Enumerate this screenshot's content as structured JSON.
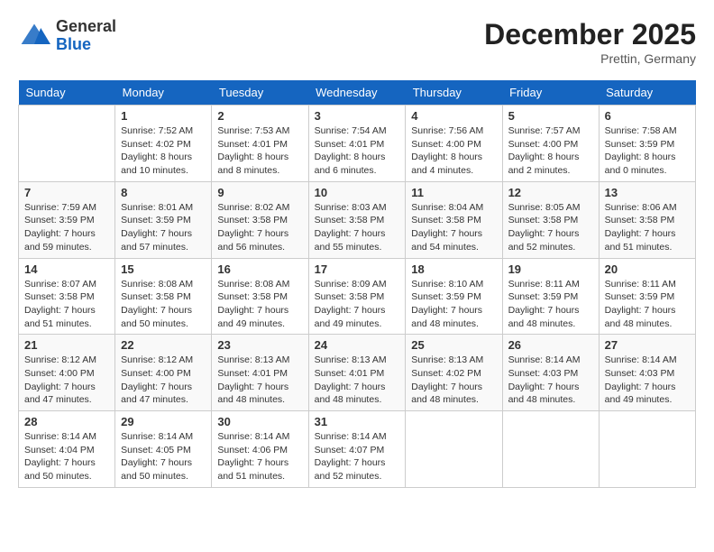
{
  "header": {
    "logo_general": "General",
    "logo_blue": "Blue",
    "month_title": "December 2025",
    "location": "Prettin, Germany"
  },
  "weekdays": [
    "Sunday",
    "Monday",
    "Tuesday",
    "Wednesday",
    "Thursday",
    "Friday",
    "Saturday"
  ],
  "weeks": [
    [
      null,
      {
        "day": 1,
        "sunrise": "7:52 AM",
        "sunset": "4:02 PM",
        "daylight": "8 hours and 10 minutes."
      },
      {
        "day": 2,
        "sunrise": "7:53 AM",
        "sunset": "4:01 PM",
        "daylight": "8 hours and 8 minutes."
      },
      {
        "day": 3,
        "sunrise": "7:54 AM",
        "sunset": "4:01 PM",
        "daylight": "8 hours and 6 minutes."
      },
      {
        "day": 4,
        "sunrise": "7:56 AM",
        "sunset": "4:00 PM",
        "daylight": "8 hours and 4 minutes."
      },
      {
        "day": 5,
        "sunrise": "7:57 AM",
        "sunset": "4:00 PM",
        "daylight": "8 hours and 2 minutes."
      },
      {
        "day": 6,
        "sunrise": "7:58 AM",
        "sunset": "3:59 PM",
        "daylight": "8 hours and 0 minutes."
      }
    ],
    [
      {
        "day": 7,
        "sunrise": "7:59 AM",
        "sunset": "3:59 PM",
        "daylight": "7 hours and 59 minutes."
      },
      {
        "day": 8,
        "sunrise": "8:01 AM",
        "sunset": "3:59 PM",
        "daylight": "7 hours and 57 minutes."
      },
      {
        "day": 9,
        "sunrise": "8:02 AM",
        "sunset": "3:58 PM",
        "daylight": "7 hours and 56 minutes."
      },
      {
        "day": 10,
        "sunrise": "8:03 AM",
        "sunset": "3:58 PM",
        "daylight": "7 hours and 55 minutes."
      },
      {
        "day": 11,
        "sunrise": "8:04 AM",
        "sunset": "3:58 PM",
        "daylight": "7 hours and 54 minutes."
      },
      {
        "day": 12,
        "sunrise": "8:05 AM",
        "sunset": "3:58 PM",
        "daylight": "7 hours and 52 minutes."
      },
      {
        "day": 13,
        "sunrise": "8:06 AM",
        "sunset": "3:58 PM",
        "daylight": "7 hours and 51 minutes."
      }
    ],
    [
      {
        "day": 14,
        "sunrise": "8:07 AM",
        "sunset": "3:58 PM",
        "daylight": "7 hours and 51 minutes."
      },
      {
        "day": 15,
        "sunrise": "8:08 AM",
        "sunset": "3:58 PM",
        "daylight": "7 hours and 50 minutes."
      },
      {
        "day": 16,
        "sunrise": "8:08 AM",
        "sunset": "3:58 PM",
        "daylight": "7 hours and 49 minutes."
      },
      {
        "day": 17,
        "sunrise": "8:09 AM",
        "sunset": "3:58 PM",
        "daylight": "7 hours and 49 minutes."
      },
      {
        "day": 18,
        "sunrise": "8:10 AM",
        "sunset": "3:59 PM",
        "daylight": "7 hours and 48 minutes."
      },
      {
        "day": 19,
        "sunrise": "8:11 AM",
        "sunset": "3:59 PM",
        "daylight": "7 hours and 48 minutes."
      },
      {
        "day": 20,
        "sunrise": "8:11 AM",
        "sunset": "3:59 PM",
        "daylight": "7 hours and 48 minutes."
      }
    ],
    [
      {
        "day": 21,
        "sunrise": "8:12 AM",
        "sunset": "4:00 PM",
        "daylight": "7 hours and 47 minutes."
      },
      {
        "day": 22,
        "sunrise": "8:12 AM",
        "sunset": "4:00 PM",
        "daylight": "7 hours and 47 minutes."
      },
      {
        "day": 23,
        "sunrise": "8:13 AM",
        "sunset": "4:01 PM",
        "daylight": "7 hours and 48 minutes."
      },
      {
        "day": 24,
        "sunrise": "8:13 AM",
        "sunset": "4:01 PM",
        "daylight": "7 hours and 48 minutes."
      },
      {
        "day": 25,
        "sunrise": "8:13 AM",
        "sunset": "4:02 PM",
        "daylight": "7 hours and 48 minutes."
      },
      {
        "day": 26,
        "sunrise": "8:14 AM",
        "sunset": "4:03 PM",
        "daylight": "7 hours and 48 minutes."
      },
      {
        "day": 27,
        "sunrise": "8:14 AM",
        "sunset": "4:03 PM",
        "daylight": "7 hours and 49 minutes."
      }
    ],
    [
      {
        "day": 28,
        "sunrise": "8:14 AM",
        "sunset": "4:04 PM",
        "daylight": "7 hours and 50 minutes."
      },
      {
        "day": 29,
        "sunrise": "8:14 AM",
        "sunset": "4:05 PM",
        "daylight": "7 hours and 50 minutes."
      },
      {
        "day": 30,
        "sunrise": "8:14 AM",
        "sunset": "4:06 PM",
        "daylight": "7 hours and 51 minutes."
      },
      {
        "day": 31,
        "sunrise": "8:14 AM",
        "sunset": "4:07 PM",
        "daylight": "7 hours and 52 minutes."
      },
      null,
      null,
      null
    ]
  ]
}
